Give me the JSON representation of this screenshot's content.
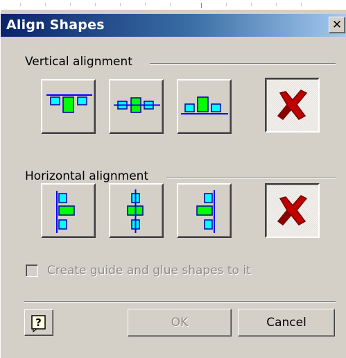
{
  "dialog": {
    "title": "Align Shapes",
    "close_icon": "close-x"
  },
  "vertical": {
    "label": "Vertical alignment",
    "buttons": [
      {
        "icon": "align-top-icon"
      },
      {
        "icon": "align-middle-icon"
      },
      {
        "icon": "align-bottom-icon"
      },
      {
        "icon": "no-alignment-x-icon",
        "pressed": true
      }
    ]
  },
  "horizontal": {
    "label": "Horizontal alignment",
    "buttons": [
      {
        "icon": "align-left-icon"
      },
      {
        "icon": "align-center-icon"
      },
      {
        "icon": "align-right-icon"
      },
      {
        "icon": "no-alignment-x-icon",
        "pressed": true
      }
    ]
  },
  "options": {
    "guide_label": "Create guide and glue shapes to it",
    "guide_checked": false,
    "guide_enabled": false
  },
  "footer": {
    "help_icon": "help-question-icon",
    "ok_label": "OK",
    "cancel_label": "Cancel"
  },
  "colors": {
    "shape_fill_light": "#00ffff",
    "shape_fill_green": "#00ff00",
    "guide_line": "#0000ff",
    "x_red": "#c00000",
    "title_start": "#0a246a",
    "title_end": "#a6caf0",
    "dialog_face": "#d4d0c8"
  }
}
